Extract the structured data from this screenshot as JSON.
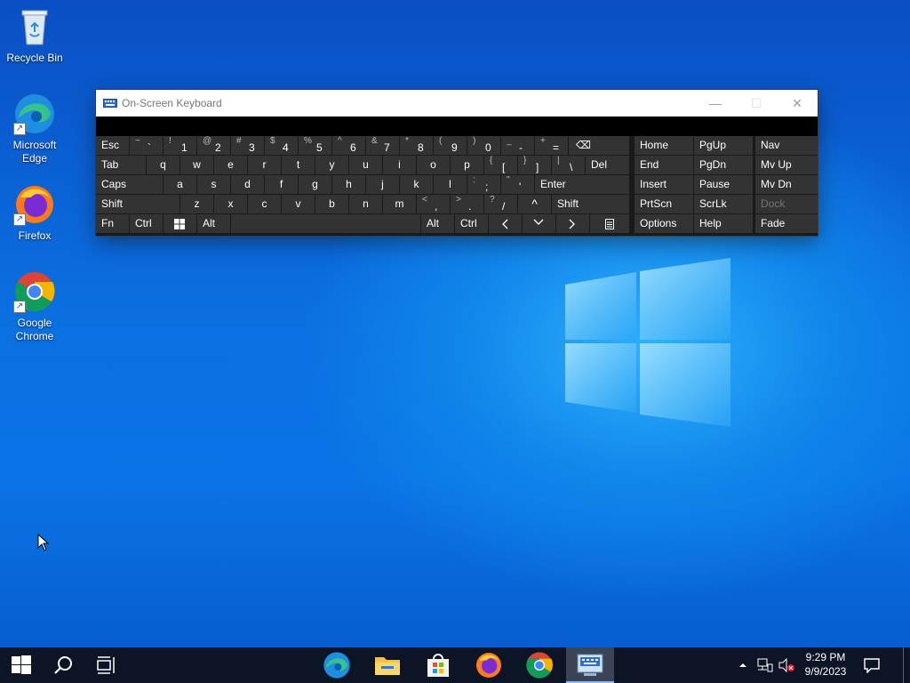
{
  "desktop": {
    "icons": [
      {
        "label": "Recycle Bin"
      },
      {
        "label": "Microsoft Edge"
      },
      {
        "label": "Firefox"
      },
      {
        "label": "Google Chrome"
      }
    ]
  },
  "osk": {
    "title": "On-Screen Keyboard",
    "controls": {
      "minimize": "—",
      "maximize": "☐",
      "close": "✕"
    },
    "row1": [
      {
        "label": "Esc"
      },
      {
        "sup": "~",
        "main": "`"
      },
      {
        "sup": "!",
        "main": "1"
      },
      {
        "sup": "@",
        "main": "2"
      },
      {
        "sup": "#",
        "main": "3"
      },
      {
        "sup": "$",
        "main": "4"
      },
      {
        "sup": "%",
        "main": "5"
      },
      {
        "sup": "^",
        "main": "6"
      },
      {
        "sup": "&",
        "main": "7"
      },
      {
        "sup": "*",
        "main": "8"
      },
      {
        "sup": "(",
        "main": "9"
      },
      {
        "sup": ")",
        "main": "0"
      },
      {
        "sup": "_",
        "main": "-"
      },
      {
        "sup": "+",
        "main": "="
      },
      {
        "label": "⌫"
      }
    ],
    "row2": [
      {
        "label": "Tab"
      },
      {
        "label": "q"
      },
      {
        "label": "w"
      },
      {
        "label": "e"
      },
      {
        "label": "r"
      },
      {
        "label": "t"
      },
      {
        "label": "y"
      },
      {
        "label": "u"
      },
      {
        "label": "i"
      },
      {
        "label": "o"
      },
      {
        "label": "p"
      },
      {
        "sup": "{",
        "main": "["
      },
      {
        "sup": "}",
        "main": "]"
      },
      {
        "sup": "|",
        "main": "\\"
      },
      {
        "label": "Del"
      }
    ],
    "row3": [
      {
        "label": "Caps"
      },
      {
        "label": "a"
      },
      {
        "label": "s"
      },
      {
        "label": "d"
      },
      {
        "label": "f"
      },
      {
        "label": "g"
      },
      {
        "label": "h"
      },
      {
        "label": "j"
      },
      {
        "label": "k"
      },
      {
        "label": "l"
      },
      {
        "sup": ":",
        "main": ";"
      },
      {
        "sup": "\"",
        "main": "'"
      },
      {
        "label": "Enter"
      }
    ],
    "row4": [
      {
        "label": "Shift"
      },
      {
        "label": "z"
      },
      {
        "label": "x"
      },
      {
        "label": "c"
      },
      {
        "label": "v"
      },
      {
        "label": "b"
      },
      {
        "label": "n"
      },
      {
        "label": "m"
      },
      {
        "sup": "<",
        "main": ","
      },
      {
        "sup": ">",
        "main": "."
      },
      {
        "sup": "?",
        "main": "/"
      },
      {
        "label": "^"
      },
      {
        "label": "Shift"
      }
    ],
    "row5": [
      {
        "label": "Fn"
      },
      {
        "label": "Ctrl"
      },
      {
        "label": "win-icon"
      },
      {
        "label": "Alt"
      },
      {
        "label": ""
      },
      {
        "label": "Alt"
      },
      {
        "label": "Ctrl"
      },
      {
        "label": "<"
      },
      {
        "label": "v"
      },
      {
        "label": ">"
      },
      {
        "label": "menu-icon"
      }
    ],
    "nav": [
      [
        "Home",
        "PgUp",
        "Nav"
      ],
      [
        "End",
        "PgDn",
        "Mv Up"
      ],
      [
        "Insert",
        "Pause",
        "Mv Dn"
      ],
      [
        "PrtScn",
        "ScrLk",
        "Dock"
      ],
      [
        "Options",
        "Help",
        "Fade"
      ]
    ]
  },
  "taskbar": {
    "apps": [
      {
        "name": "edge-icon"
      },
      {
        "name": "file-explorer-icon"
      },
      {
        "name": "store-icon"
      },
      {
        "name": "firefox-icon"
      },
      {
        "name": "chrome-icon"
      },
      {
        "name": "on-screen-keyboard-icon"
      }
    ],
    "time": "9:29 PM",
    "date": "9/9/2023"
  }
}
